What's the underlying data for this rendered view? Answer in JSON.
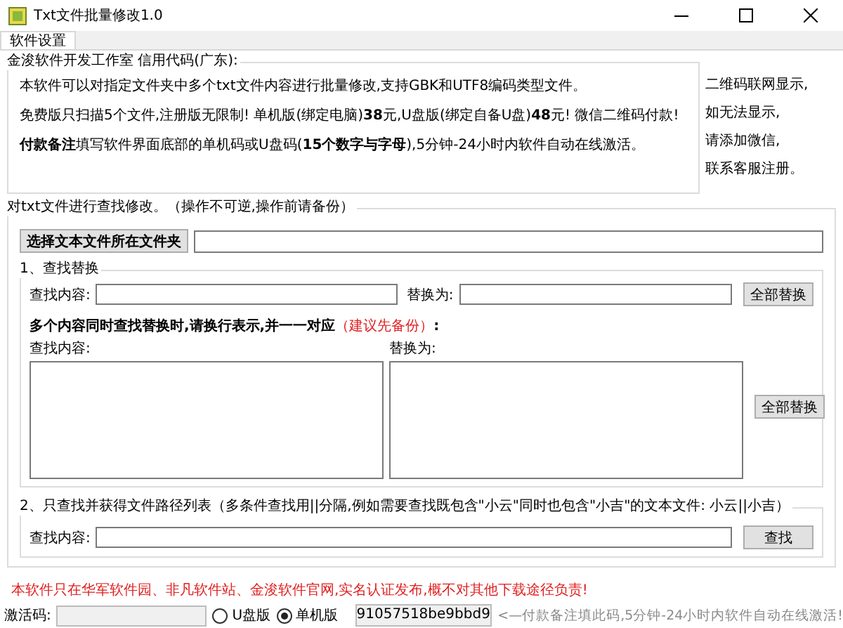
{
  "window": {
    "title": "Txt文件批量修改1.0"
  },
  "tabs": [
    {
      "label": "软件设置",
      "selected": true
    }
  ],
  "info": {
    "title": "金浚软件开发工作室 信用代码(广东):",
    "lines": [
      "本软件可以对指定文件夹中多个txt文件内容进行批量修改,支持GBK和UTF8编码类型文件。",
      "免费版只扫描5个文件,注册版无限制! 单机版(绑定电脑)**38**元,U盘版(绑定自备U盘)**48**元! 微信二维码付款!",
      "**付款备注**填写软件界面底部的单机码或U盘码(**15个数字与字母**),5分钟-24小时内软件自动在线激活。"
    ],
    "side_lines": [
      "二维码联网显示,",
      "如无法显示,",
      "请添加微信,",
      "联系客服注册。"
    ]
  },
  "edit": {
    "title": "对txt文件进行查找修改。（操作不可逆,操作前请备份）",
    "folder_button": "选择文本文件所在文件夹",
    "replace": {
      "title": "1、查找替换",
      "find_label": "查找内容:",
      "replace_label": "替换为:",
      "button": "全部替换",
      "multi_note": "多个内容同时查找替换时,请换行表示,并一一对应",
      "multi_warning": "（建议先备份）",
      "multi_colon": ":",
      "multi_find_label": "查找内容:",
      "multi_replace_label": "替换为:",
      "multi_button": "全部替换"
    },
    "search": {
      "title": "2、只查找并获得文件路径列表（多条件查找用||分隔,例如需要查找既包含\"小云\"同时也包含\"小吉\"的文本文件: 小云||小吉）",
      "find_label": "查找内容:",
      "button": "查找"
    }
  },
  "notice": "本软件只在华军软件园、非凡软件站、金浚软件官网,实名认证发布,概不对其他下载途径负责!",
  "footer": {
    "code_label": "激活码:",
    "editions": [
      {
        "label": "U盘版",
        "selected": false
      },
      {
        "label": "单机版",
        "selected": true
      }
    ],
    "machine_code": "91057518be9bbd9",
    "hint": "<—付款备注填此码,5分钟-24小时内软件自动在线激活!"
  }
}
